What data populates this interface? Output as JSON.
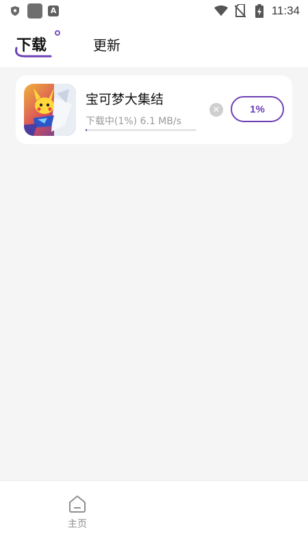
{
  "status_bar": {
    "time": "11:34",
    "icons": [
      "shield-icon",
      "app-square-icon",
      "a-icon",
      "wifi-icon",
      "no-sim-icon",
      "battery-charging-icon"
    ]
  },
  "tabs": [
    {
      "label": "下载",
      "active": true
    },
    {
      "label": "更新",
      "active": false
    }
  ],
  "downloads": [
    {
      "name": "宝可梦大集结",
      "status": "下载中(1%) 6.1 MB/s",
      "progress_percent": 1,
      "action_label": "1%"
    }
  ],
  "bottom_nav": {
    "home_label": "主页"
  },
  "colors": {
    "accent": "#6b3fb5",
    "background": "#f5f5f5"
  }
}
